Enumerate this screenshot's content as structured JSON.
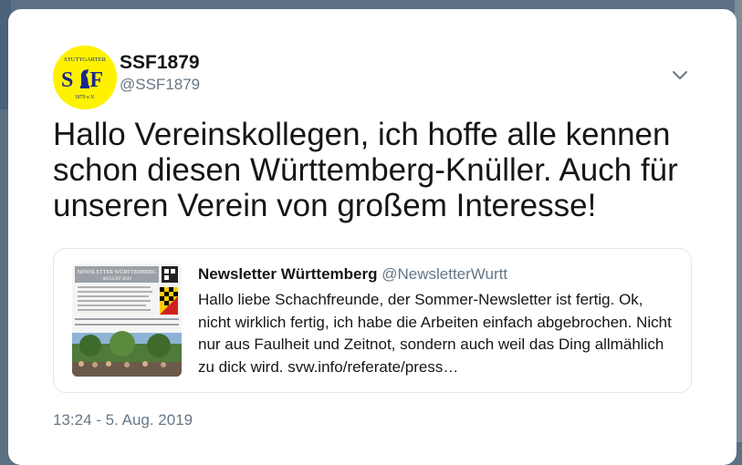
{
  "tweet": {
    "display_name": "SSF1879",
    "handle": "@SSF1879",
    "text": "Hallo Vereinskollegen, ich hoffe alle kennen schon diesen Württemberg-Knüller. Auch für unseren Verein von großem Interesse!",
    "timestamp": "13:24 - 5. Aug. 2019"
  },
  "avatar": {
    "top_text": "STUTTGARTER",
    "letters": "S F",
    "bottom_text": "1879 e.V."
  },
  "quote": {
    "display_name": "Newsletter Württemberg",
    "handle": "@NewsletterWurtt",
    "text": "Hallo liebe Schachfreunde, der Sommer-Newsletter ist fertig. Ok, nicht wirklich fertig, ich habe die Arbeiten einfach abgebrochen. Nicht nur aus Faulheit und Zeitnot, sondern auch weil das Ding allmählich zu dick wird.  svw.info/referate/press…",
    "thumb_title": "NEWSLETTER WÜRTTEMBERG",
    "thumb_subtitle": "AUGUST 2019"
  },
  "colors": {
    "text_primary": "#14171a",
    "text_secondary": "#657786",
    "avatar_yellow": "#fff200",
    "border": "#e1e8ed"
  },
  "icons": {
    "menu": "chevron-down-icon",
    "logo_piece": "chess-knight-icon"
  }
}
